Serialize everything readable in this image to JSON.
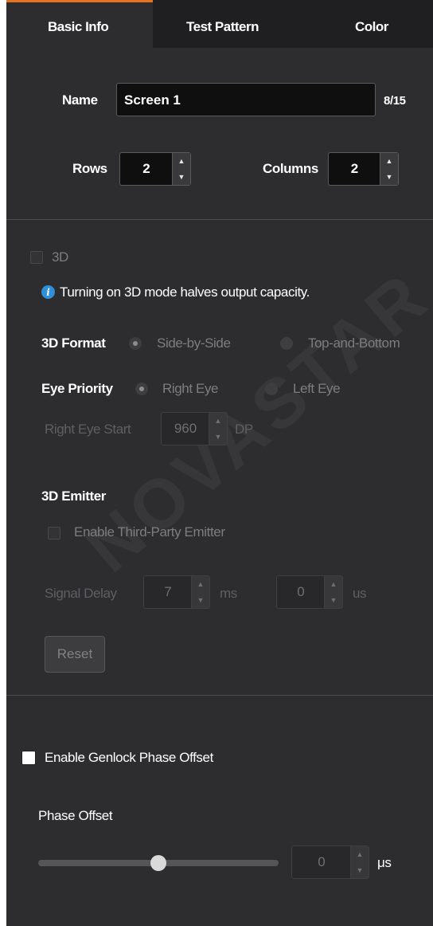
{
  "tabs": [
    {
      "label": "Basic Info",
      "active": true
    },
    {
      "label": "Test Pattern",
      "active": false
    },
    {
      "label": "Color",
      "active": false
    }
  ],
  "basic": {
    "name_label": "Name",
    "name_value": "Screen 1",
    "name_count": "8/15",
    "rows_label": "Rows",
    "rows_value": "2",
    "columns_label": "Columns",
    "columns_value": "2"
  },
  "three_d": {
    "toggle_label": "3D",
    "toggle_checked": false,
    "info_text": "Turning on 3D mode halves output capacity.",
    "format_label": "3D Format",
    "format_options": [
      "Side-by-Side",
      "Top-and-Bottom"
    ],
    "format_selected": "Side-by-Side",
    "eye_priority_label": "Eye Priority",
    "eye_options": [
      "Right Eye",
      "Left Eye"
    ],
    "eye_selected": "Right Eye",
    "right_eye_start_label": "Right Eye Start",
    "right_eye_start_value": "960",
    "right_eye_start_unit": "DP",
    "emitter_title": "3D Emitter",
    "emitter_enable_label": "Enable Third-Party Emitter",
    "emitter_enabled": false,
    "signal_delay_label": "Signal Delay",
    "signal_delay_ms": "7",
    "ms_unit": "ms",
    "signal_delay_us": "0",
    "us_unit": "us",
    "reset_label": "Reset"
  },
  "genlock": {
    "enable_label": "Enable Genlock Phase Offset",
    "enabled": false,
    "phase_offset_label": "Phase Offset",
    "phase_offset_value": "0",
    "phase_offset_unit": "μs",
    "slider_fraction": 0.5
  },
  "watermark_text": "NOVASTAR",
  "colors": {
    "panel_bg": "#2d2d30",
    "tab_bar_bg": "#1f1f21",
    "active_tab_accent": "#e37221",
    "info_blue": "#2f8fd8"
  }
}
